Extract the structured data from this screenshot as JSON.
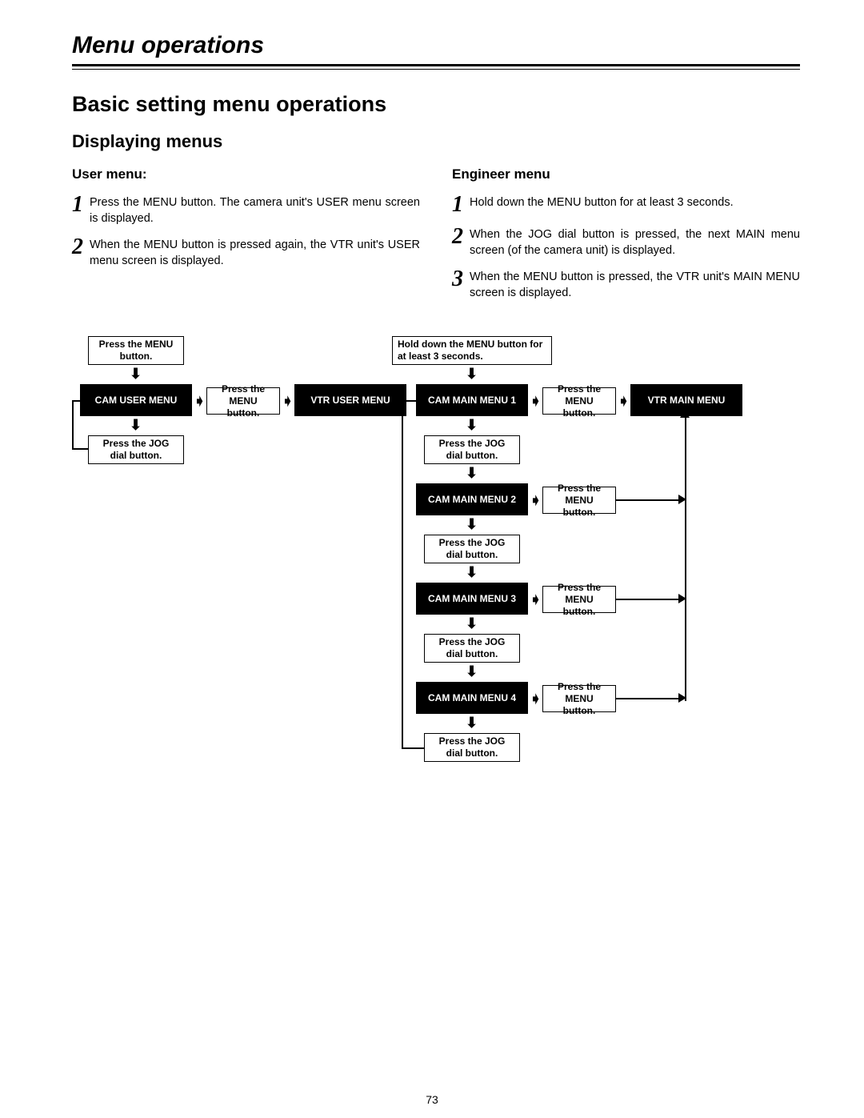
{
  "page": {
    "title": "Menu operations",
    "heading": "Basic setting menu operations",
    "subheading": "Displaying menus",
    "number": "73"
  },
  "user_menu": {
    "heading": "User menu:",
    "steps": [
      {
        "n": "1",
        "text": "Press the MENU button.\nThe camera unit's USER menu screen is displayed."
      },
      {
        "n": "2",
        "text": "When the MENU button is pressed again, the VTR unit's USER menu screen is displayed."
      }
    ]
  },
  "engineer_menu": {
    "heading": "Engineer menu",
    "steps": [
      {
        "n": "1",
        "text": "Hold down the MENU button for at least 3 seconds."
      },
      {
        "n": "2",
        "text": "When the JOG dial button is pressed, the next MAIN menu screen (of the camera unit) is displayed."
      },
      {
        "n": "3",
        "text": "When the MENU button is pressed, the VTR unit's MAIN MENU screen is displayed."
      }
    ]
  },
  "diagram": {
    "press_menu": "Press the MENU\nbutton.",
    "press_menu_short": "Press the\nMENU button.",
    "press_jog": "Press the JOG\ndial button.",
    "hold_menu": "Hold down the MENU button\nfor at least 3 seconds.",
    "cam_user": "CAM USER MENU",
    "vtr_user": "VTR USER MENU",
    "cam_main1": "CAM MAIN MENU 1",
    "cam_main2": "CAM MAIN MENU 2",
    "cam_main3": "CAM MAIN MENU 3",
    "cam_main4": "CAM MAIN MENU 4",
    "vtr_main": "VTR MAIN MENU"
  }
}
